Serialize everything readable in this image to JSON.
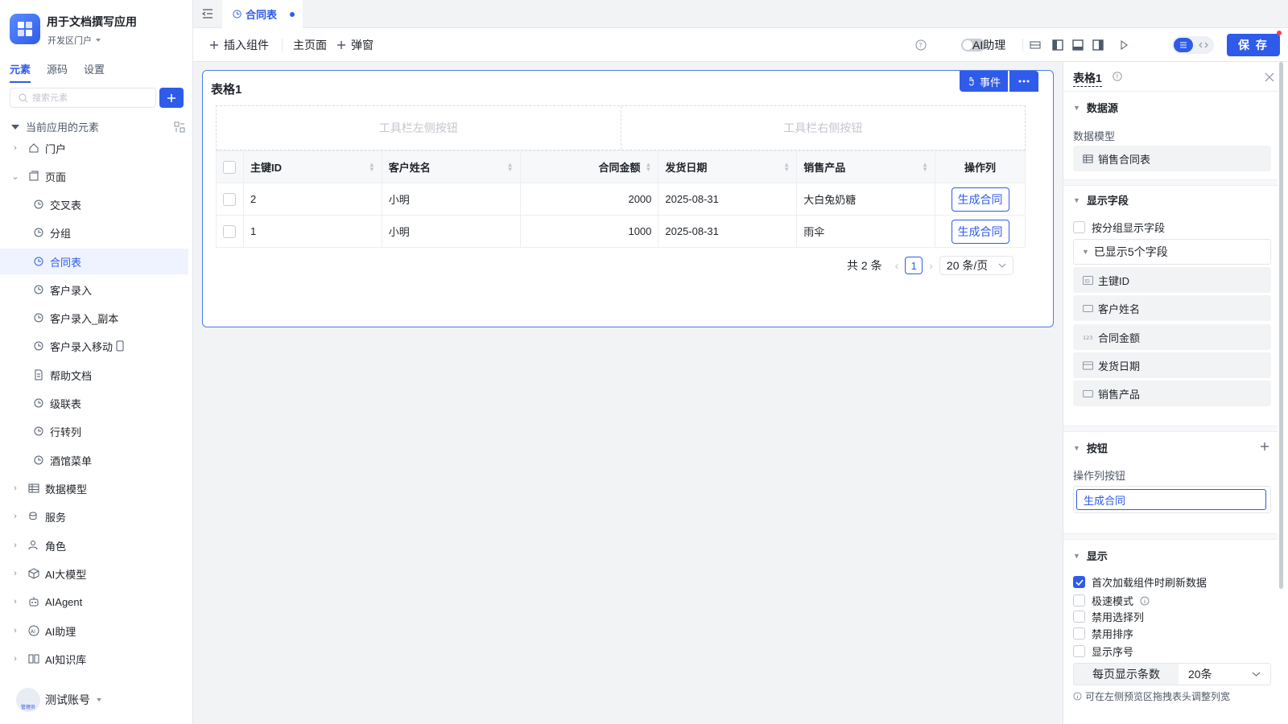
{
  "app": {
    "title": "用于文档撰写应用",
    "env": "开发区门户"
  },
  "sidebar": {
    "tabs": [
      "元素",
      "源码",
      "设置"
    ],
    "search_placeholder": "搜索元素",
    "tree_header": "当前应用的元素",
    "items": [
      {
        "label": "门户"
      },
      {
        "label": "页面"
      },
      {
        "label": "交叉表"
      },
      {
        "label": "分组"
      },
      {
        "label": "合同表"
      },
      {
        "label": "客户录入"
      },
      {
        "label": "客户录入_副本"
      },
      {
        "label": "客户录入移动"
      },
      {
        "label": "帮助文档"
      },
      {
        "label": "级联表"
      },
      {
        "label": "行转列"
      },
      {
        "label": "酒馆菜单"
      },
      {
        "label": "数据模型"
      },
      {
        "label": "服务"
      },
      {
        "label": "角色"
      },
      {
        "label": "AI大模型"
      },
      {
        "label": "AIAgent"
      },
      {
        "label": "AI助理"
      },
      {
        "label": "AI知识库"
      }
    ],
    "user": {
      "name": "测试账号",
      "badge": "管理员"
    }
  },
  "tabbar": {
    "active_tab": "合同表"
  },
  "toolbar": {
    "insert_component": "插入组件",
    "main_page": "主页面",
    "popup": "弹窗",
    "ai_assistant": "AI助理",
    "save": "保 存"
  },
  "canvas": {
    "table_title": "表格1",
    "event_btn": "事件",
    "toolbar_left": "工具栏左侧按钮",
    "toolbar_right": "工具栏右侧按钮",
    "columns": [
      "主键ID",
      "客户姓名",
      "合同金额",
      "发货日期",
      "销售产品",
      "操作列"
    ],
    "rows": [
      {
        "id": "2",
        "name": "小明",
        "amount": "2000",
        "date": "2025-08-31",
        "product": "大白兔奶糖",
        "action": "生成合同"
      },
      {
        "id": "1",
        "name": "小明",
        "amount": "1000",
        "date": "2025-08-31",
        "product": "雨伞",
        "action": "生成合同"
      }
    ],
    "pager": {
      "total": "共 2 条",
      "page": "1",
      "page_size": "20 条/页"
    }
  },
  "rpanel": {
    "title": "表格1",
    "datasource_section": "数据源",
    "data_model_label": "数据模型",
    "data_model_value": "销售合同表",
    "fields_section": "显示字段",
    "group_display": "按分组显示字段",
    "shown_fields": "已显示5个字段",
    "fields": [
      {
        "label": "主键ID",
        "icon": "id-icon"
      },
      {
        "label": "客户姓名",
        "icon": "text-field-icon"
      },
      {
        "label": "合同金额",
        "icon": "number-icon"
      },
      {
        "label": "发货日期",
        "icon": "calendar-icon"
      },
      {
        "label": "销售产品",
        "icon": "text-field-icon"
      }
    ],
    "buttons_section": "按钮",
    "action_buttons_label": "操作列按钮",
    "action_button_value": "生成合同",
    "display_section": "显示",
    "options": [
      {
        "label": "首次加载组件时刷新数据",
        "checked": true
      },
      {
        "label": "极速模式",
        "checked": false
      },
      {
        "label": "禁用选择列",
        "checked": false
      },
      {
        "label": "禁用排序",
        "checked": false
      },
      {
        "label": "显示序号",
        "checked": false
      }
    ],
    "page_size_label": "每页显示条数",
    "page_size_value": "20条",
    "hint": "可在左侧预览区拖拽表头调整列宽"
  },
  "colors": {
    "accent": "#2f5bea",
    "danger": "#f53f3f"
  }
}
